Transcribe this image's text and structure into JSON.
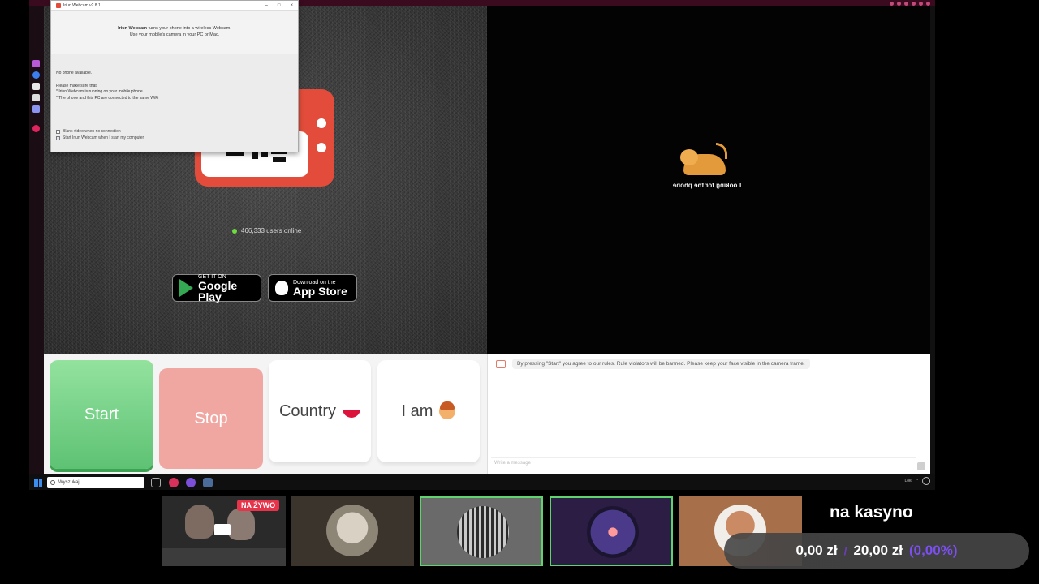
{
  "iriun": {
    "title": "Iriun Webcam v2.8.1",
    "head_brand": "Iriun Webcam",
    "head_line1_rest": " turns your phone into a wireless Webcam.",
    "head_line2": "Use your mobile's camera in your PC or Mac.",
    "status": "No phone available.",
    "hint_title": "Please make sure that:",
    "hint_1": "* Iriun Webcam is running on your mobile phone",
    "hint_2": "* The phone and this PC are connected to the same WiFi",
    "check_blank": "Blank video when no connection",
    "check_start": "Start Iriun Webcam when I start my computer",
    "minimize": "–",
    "maximize": "□",
    "close": "×"
  },
  "left_pane": {
    "online_count": "466,333 users online",
    "google_small": "GET IT ON",
    "google_big": "Google Play",
    "apple_small": "Download on the",
    "apple_big": "App Store"
  },
  "right_pane": {
    "looking": "Looking for the phone"
  },
  "controls": {
    "start": "Start",
    "stop": "Stop",
    "country": "Country",
    "iam": "I am"
  },
  "chat": {
    "notice": "By pressing \"Start\" you agree to our rules. Rule violators will be banned. Please keep your face visible in the camera frame.",
    "placeholder": "Write a message"
  },
  "taskbar": {
    "search": "Wyszukaj",
    "tray_lang": "Lokl"
  },
  "overlay": {
    "live_badge": "NA ŻYWO",
    "title": "na kasyno",
    "balance_current": "0,00 zł",
    "balance_separator": "/",
    "balance_goal": "20,00 zł",
    "balance_pct": "(0,00%)"
  },
  "colors": {
    "start_green": "#5ec274",
    "stop_red": "#f0a7a2",
    "tv_red": "#e34c3a",
    "live_red": "#e8344a",
    "accent_purple": "#7b4ff0"
  }
}
